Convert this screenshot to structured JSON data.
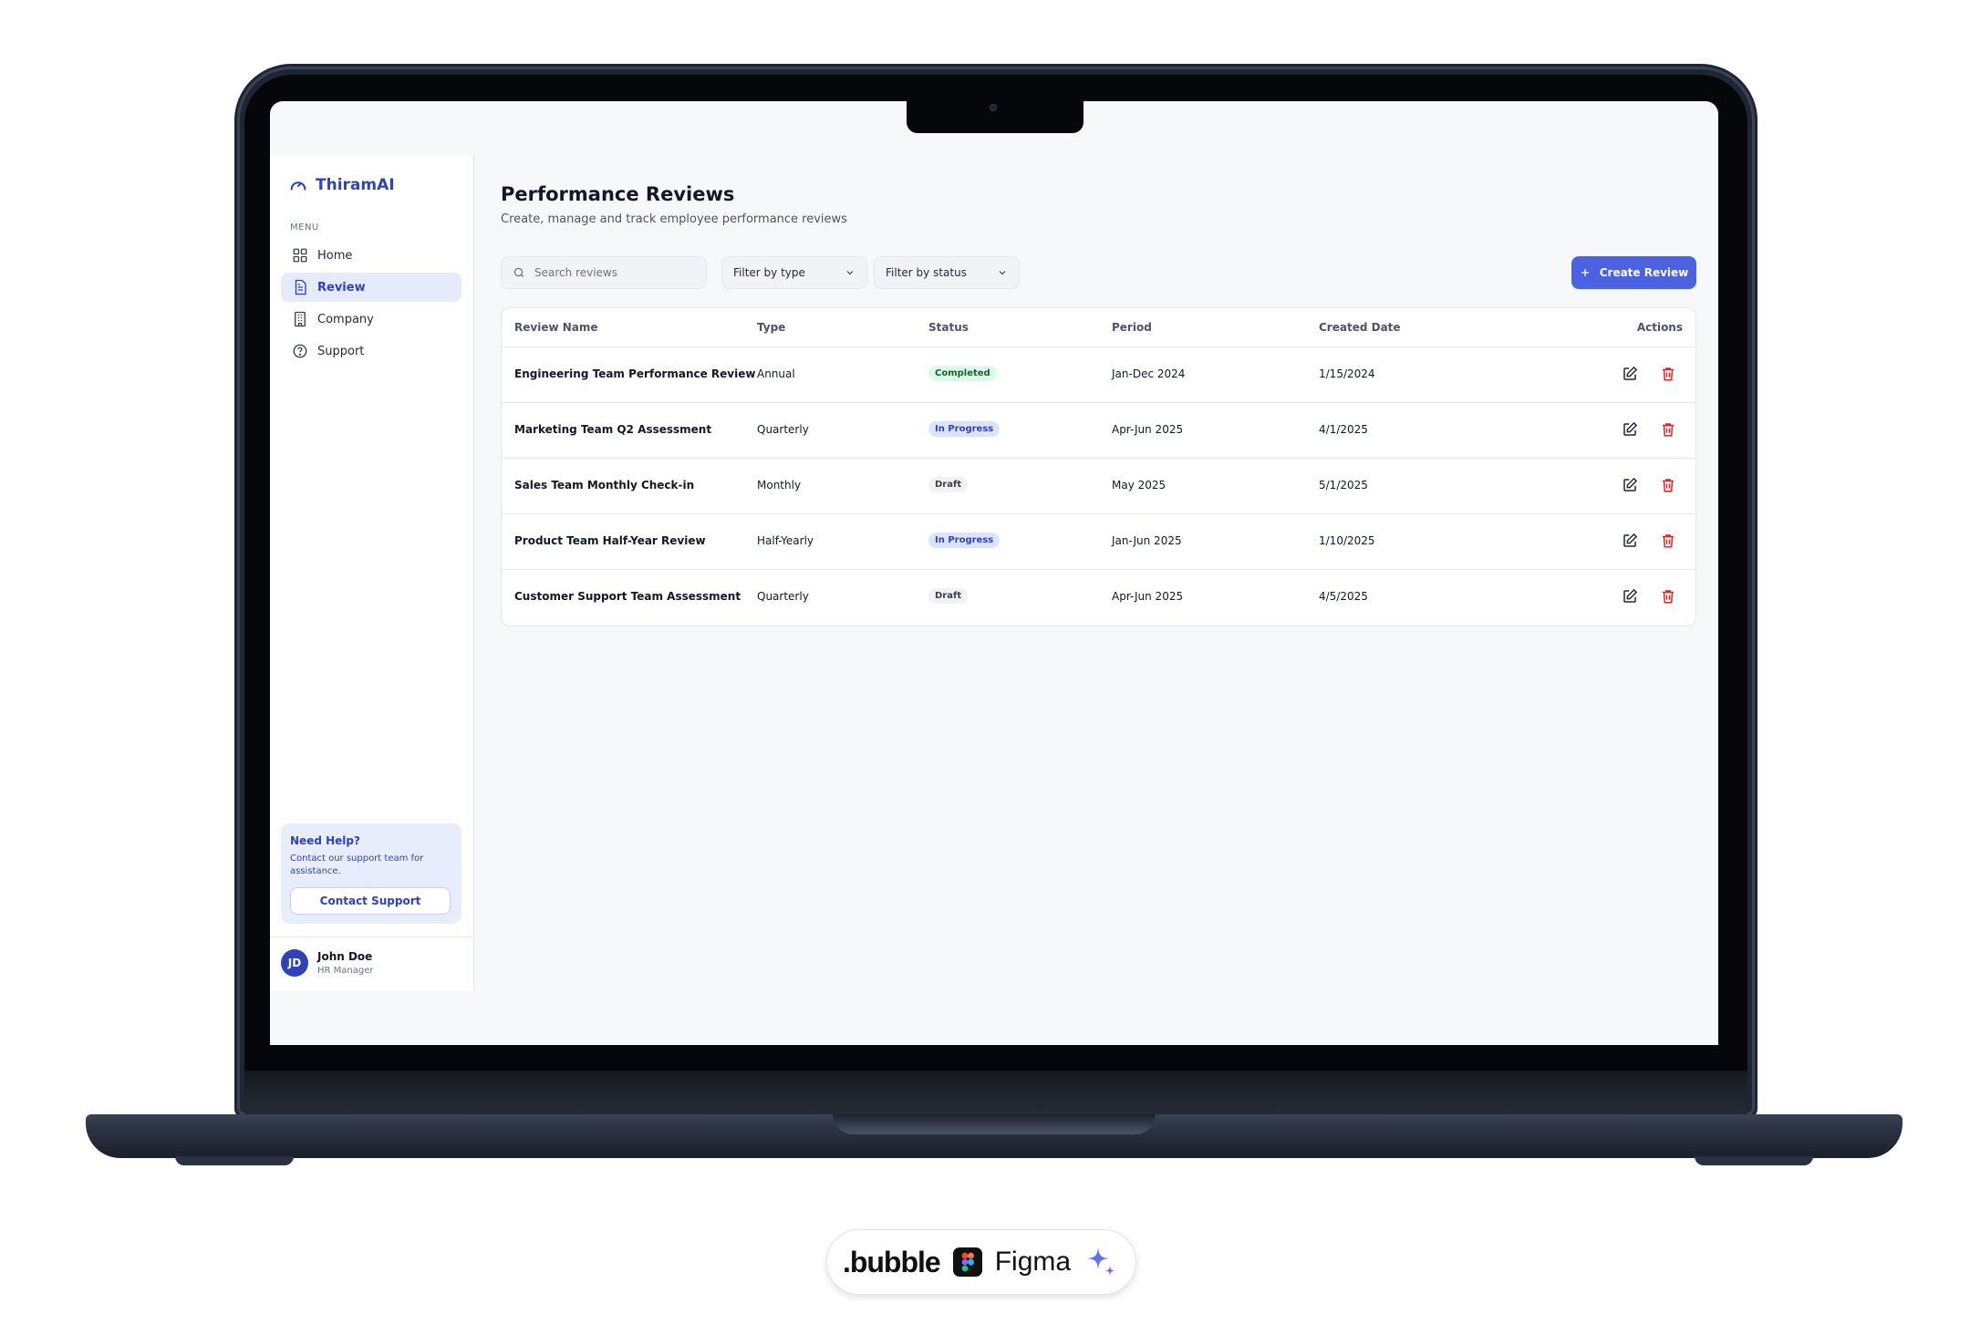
{
  "sidebar": {
    "brand": "ThiramAI",
    "menu_label": "MENU",
    "items": [
      {
        "label": "Home",
        "icon": "grid-icon",
        "active": false
      },
      {
        "label": "Review",
        "icon": "document-icon",
        "active": true
      },
      {
        "label": "Company",
        "icon": "building-icon",
        "active": false
      },
      {
        "label": "Support",
        "icon": "help-circle-icon",
        "active": false
      }
    ],
    "help": {
      "title": "Need Help?",
      "text": "Contact our support team for assistance.",
      "button": "Contact Support"
    },
    "user": {
      "initials": "JD",
      "name": "John Doe",
      "role": "HR Manager"
    }
  },
  "main": {
    "title": "Performance Reviews",
    "subtitle": "Create, manage and track employee performance reviews",
    "search_placeholder": "Search reviews",
    "filter_type": "Filter by type",
    "filter_status": "Filter by status",
    "create_button": "Create Review",
    "table": {
      "headers": [
        "Review Name",
        "Type",
        "Status",
        "Period",
        "Created Date",
        "Actions"
      ],
      "rows": [
        {
          "name": "Engineering Team Performance Review",
          "type": "Annual",
          "status": "Completed",
          "period": "Jan-Dec 2024",
          "created": "1/15/2024"
        },
        {
          "name": "Marketing Team Q2 Assessment",
          "type": "Quarterly",
          "status": "In Progress",
          "period": "Apr-Jun 2025",
          "created": "4/1/2025"
        },
        {
          "name": "Sales Team Monthly Check-in",
          "type": "Monthly",
          "status": "Draft",
          "period": "May 2025",
          "created": "5/1/2025"
        },
        {
          "name": "Product Team Half-Year Review",
          "type": "Half-Yearly",
          "status": "In Progress",
          "period": "Jan-Jun 2025",
          "created": "1/10/2025"
        },
        {
          "name": "Customer Support Team Assessment",
          "type": "Quarterly",
          "status": "Draft",
          "period": "Apr-Jun 2025",
          "created": "4/5/2025"
        }
      ]
    }
  },
  "footer_badge": {
    "bubble": ".bubble",
    "figma": "Figma"
  },
  "colors": {
    "accent": "#4b62e3",
    "brand": "#2f43b8",
    "delete": "#dc2626"
  }
}
